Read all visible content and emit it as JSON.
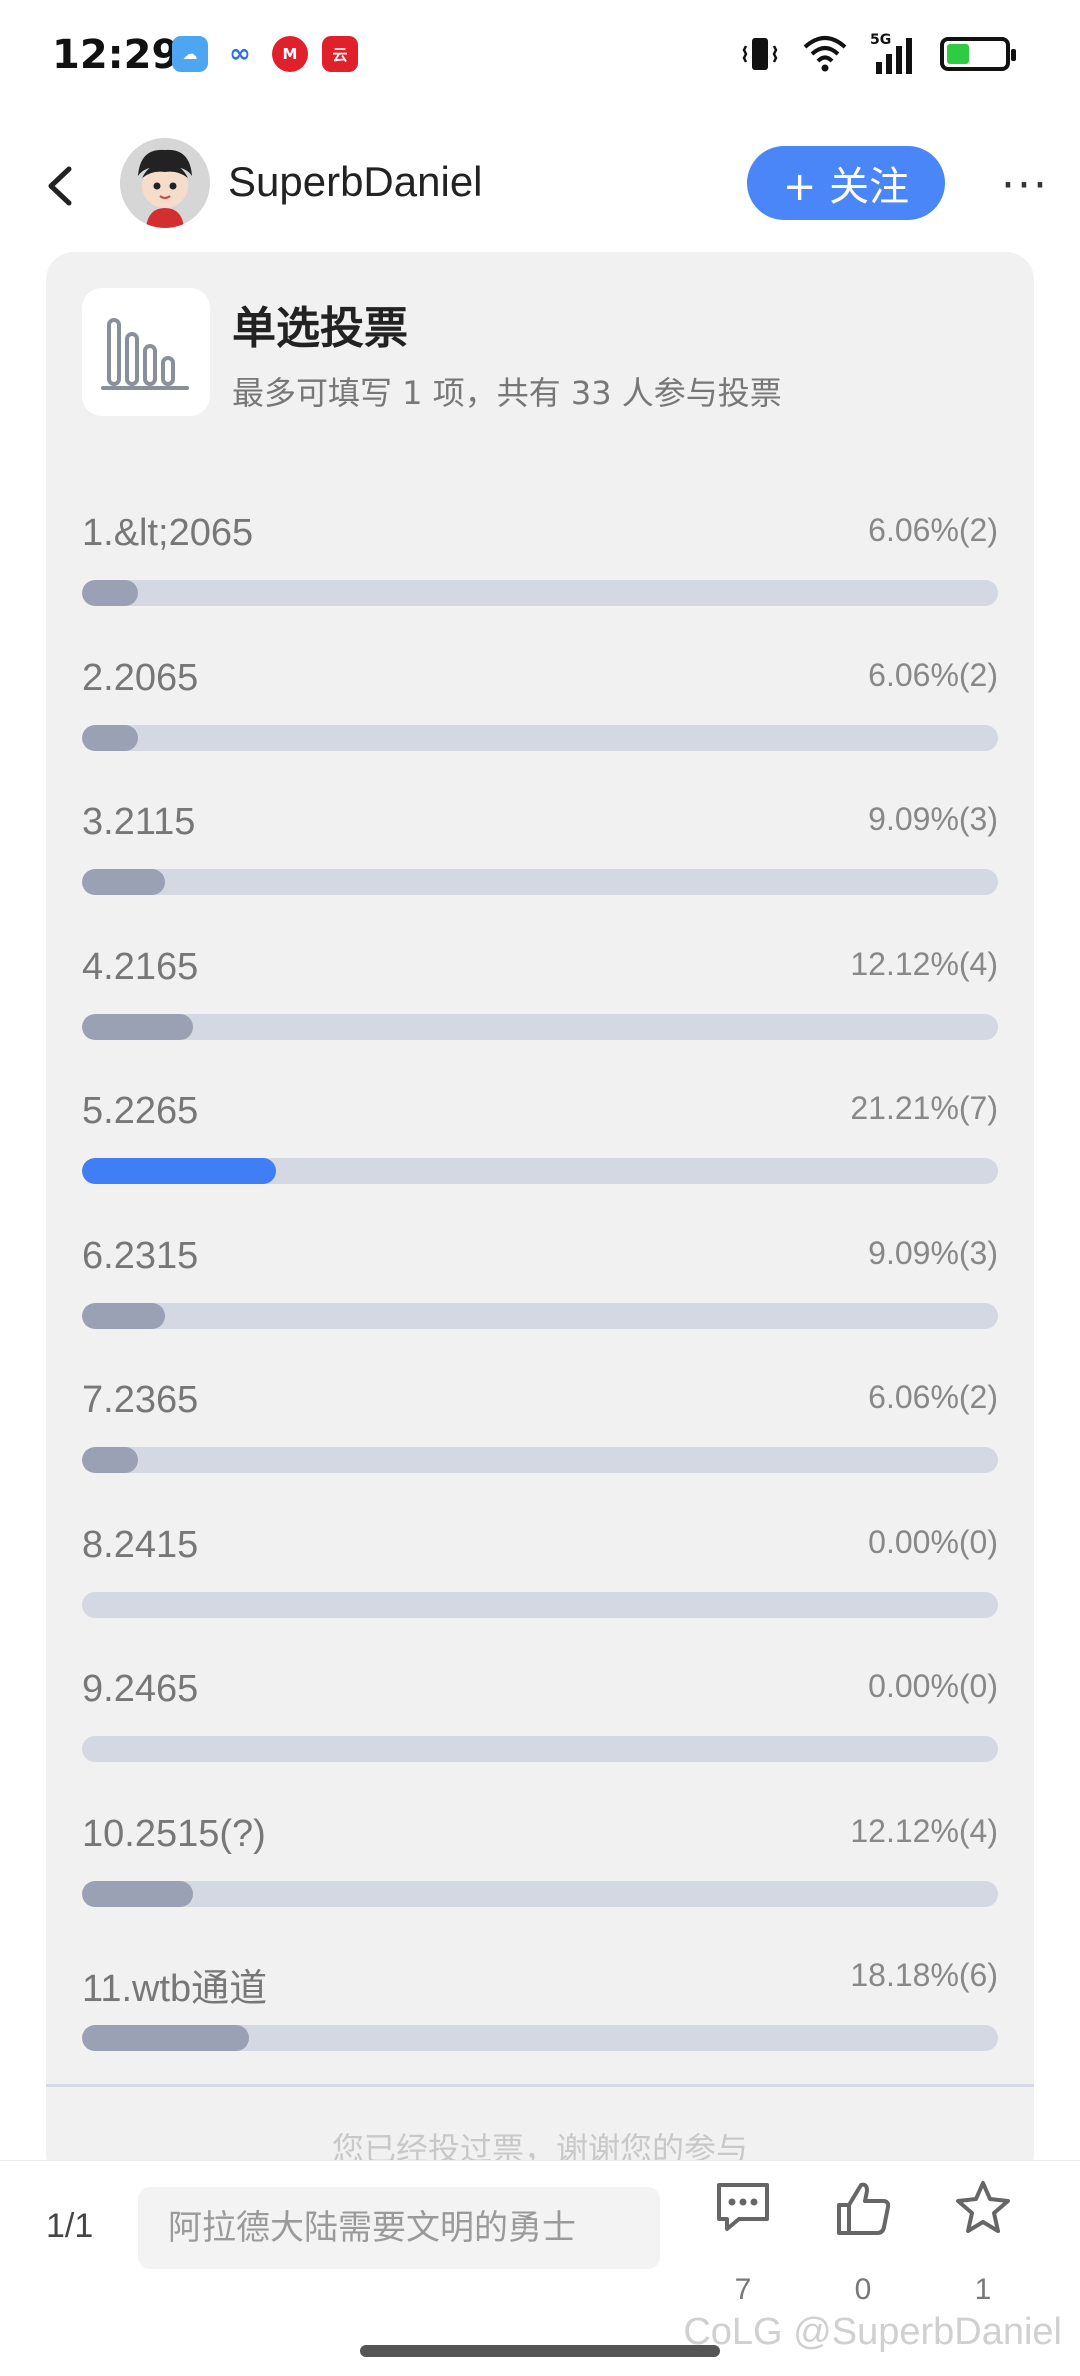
{
  "status_bar": {
    "time": "12:29",
    "network": "5G",
    "apps": [
      {
        "name": "weather-app-icon",
        "color": "#4ea6f2",
        "glyph": "☁"
      },
      {
        "name": "baidu-netdisk-icon",
        "color": "#ffffff",
        "glyph": "∞"
      },
      {
        "name": "mcdonalds-icon",
        "color": "#e0202a",
        "glyph": "M"
      },
      {
        "name": "yunshanfu-icon",
        "color": "#e0202a",
        "glyph": "云"
      }
    ]
  },
  "header": {
    "username": "SuperbDaniel",
    "follow_label": "+ 关注",
    "more_label": "···"
  },
  "poll": {
    "title": "单选投票",
    "subtitle": "最多可填写 1 项，共有 33 人参与投票",
    "options": [
      {
        "label": "1.&lt;2065",
        "result": "6.06%(2)",
        "fraction": 0.0606,
        "selected": false
      },
      {
        "label": "2.2065",
        "result": "6.06%(2)",
        "fraction": 0.0606,
        "selected": false
      },
      {
        "label": "3.2115",
        "result": "9.09%(3)",
        "fraction": 0.0909,
        "selected": false
      },
      {
        "label": "4.2165",
        "result": "12.12%(4)",
        "fraction": 0.1212,
        "selected": false
      },
      {
        "label": "5.2265",
        "result": "21.21%(7)",
        "fraction": 0.2121,
        "selected": true
      },
      {
        "label": "6.2315",
        "result": "9.09%(3)",
        "fraction": 0.0909,
        "selected": false
      },
      {
        "label": "7.2365",
        "result": "6.06%(2)",
        "fraction": 0.0606,
        "selected": false
      },
      {
        "label": "8.2415",
        "result": "0.00%(0)",
        "fraction": 0,
        "selected": false
      },
      {
        "label": "9.2465",
        "result": "0.00%(0)",
        "fraction": 0,
        "selected": false
      },
      {
        "label": "10.2515(?)",
        "result": "12.12%(4)",
        "fraction": 0.1212,
        "selected": false
      },
      {
        "label": "11.wtb通道",
        "result": "18.18%(6)",
        "fraction": 0.1818,
        "selected": false
      }
    ],
    "voted_message": "您已经投过票，谢谢您的参与",
    "colors": {
      "selected": "#3f7ef5",
      "unselected": "#9aa1b4",
      "track": "#d4d8e2"
    }
  },
  "bottom_bar": {
    "page": "1/1",
    "comment_placeholder": "阿拉德大陆需要文明的勇士",
    "comments_count": "7",
    "likes_count": "0",
    "favorites_count": "1",
    "watermark": "CoLG @SuperbDaniel"
  }
}
